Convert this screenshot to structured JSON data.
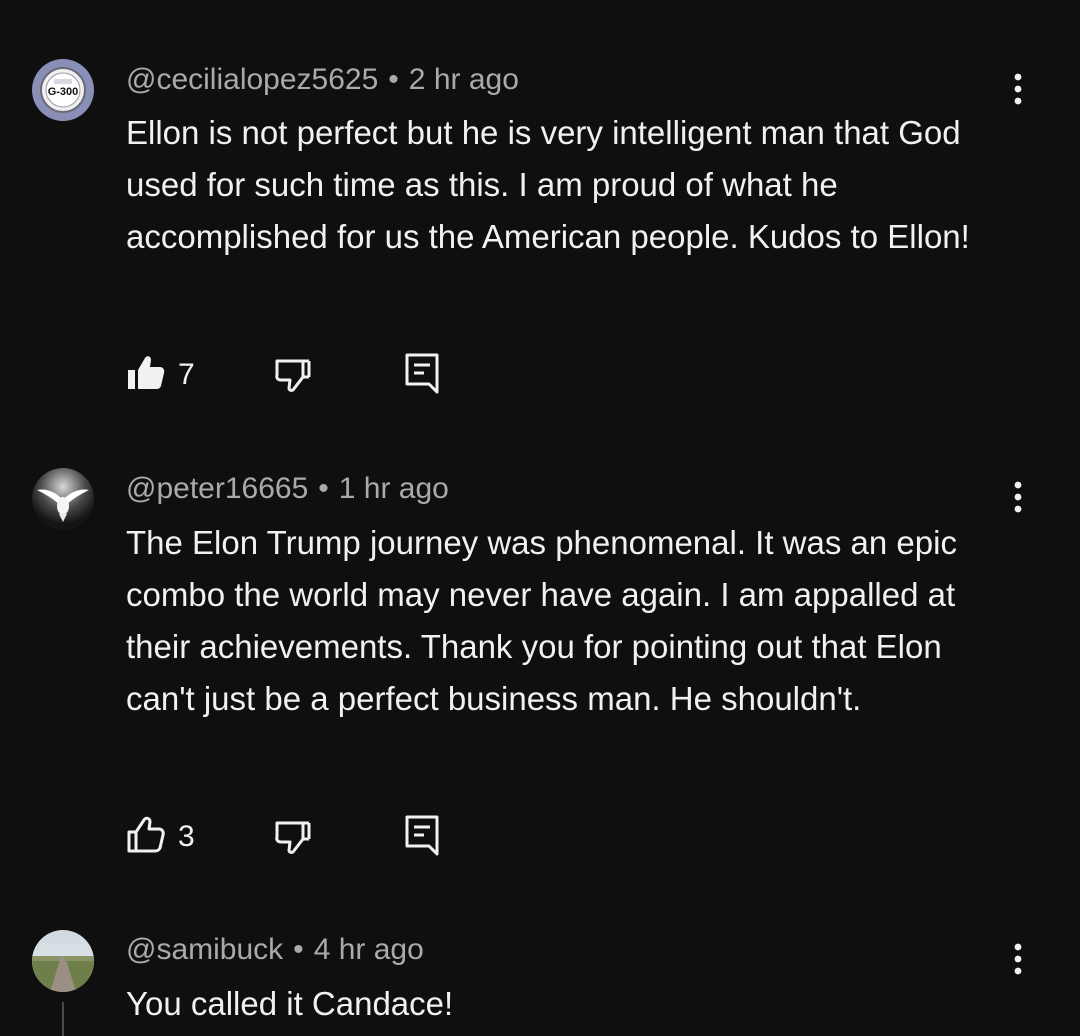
{
  "comments": [
    {
      "handle": "@cecilialopez5625",
      "time": "2 hr ago",
      "text": "Ellon is not perfect but he is very intelligent man that God used for such time as this. I am proud of what he accomplished for us the American people. Kudos to Ellon!",
      "likes": "7",
      "liked": true,
      "avatar_label": "G-300"
    },
    {
      "handle": "@peter16665",
      "time": "1 hr ago",
      "text": "The Elon Trump journey was phenomenal. It was an epic combo the world may never have again. I am appalled at their achievements. Thank you for pointing out that Elon can't just be a perfect business man. He shouldn't.",
      "likes": "3",
      "liked": false
    },
    {
      "handle": "@samibuck",
      "time": "4 hr ago",
      "text": "You called it Candace!"
    }
  ],
  "separator": "•",
  "icons": {
    "like": "thumbs-up-icon",
    "dislike": "thumbs-down-icon",
    "reply": "reply-icon",
    "more": "more-vertical-icon"
  },
  "colors": {
    "background": "#0f0f0f",
    "text": "#f1f1f1",
    "meta": "#aaaaaa"
  }
}
